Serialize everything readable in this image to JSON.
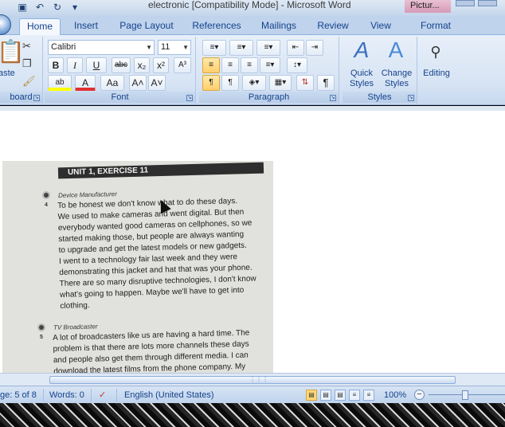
{
  "window": {
    "title": "electronic [Compatibility Mode] - Microsoft Word",
    "context_tab": "Pictur..."
  },
  "tabs": [
    "Home",
    "Insert",
    "Page Layout",
    "References",
    "Mailings",
    "Review",
    "View",
    "Format"
  ],
  "ribbon": {
    "clipboard": {
      "label": "board",
      "paste": "aste"
    },
    "font": {
      "label": "Font",
      "name": "Calibri",
      "size": "11",
      "bold": "B",
      "italic": "I",
      "underline": "U",
      "strike": "abc",
      "subscript": "x₂",
      "superscript": "x²",
      "clear": "A³",
      "highlight": "ab",
      "color": "A",
      "case": "Aa",
      "grow": "A˄",
      "shrink": "A˅"
    },
    "paragraph": {
      "label": "Paragraph"
    },
    "styles": {
      "label": "Styles",
      "quick": "Quick",
      "quick2": "Styles",
      "change": "Change",
      "change2": "Styles"
    },
    "editing": {
      "label": "Editing"
    }
  },
  "document": {
    "unit_title": "UNIT 1, EXERCISE 11",
    "speaker1": "Device Manufacturer",
    "track1": "4",
    "passage1": [
      "To be honest we don't know what to do these days.",
      "We used to make cameras and went digital. But then",
      "everybody wanted good cameras on cellphones, so we",
      "started making those, but people are always wanting",
      "to upgrade and get the latest models or new gadgets.",
      "I went to a technology fair last week and they were",
      "demonstrating this jacket and hat that was your phone.",
      "There are so many disruptive technologies, I don't know",
      "what's going to happen. Maybe we'll have to get into",
      "clothing."
    ],
    "speaker2": "TV Broadcaster",
    "track2": "5",
    "passage2": [
      "A lot of broadcasters like us are having a hard time. The",
      "problem is that there are lots more channels these days",
      "and people also get them through different media. I can",
      "download the latest films from the phone company. My"
    ]
  },
  "status": {
    "page": "ge: 5 of 8",
    "words": "Words: 0",
    "language": "English (United States)",
    "zoom": "100%"
  },
  "colors": {
    "ribbon_accent": "#15428b",
    "active_button": "#ffcf6b"
  }
}
